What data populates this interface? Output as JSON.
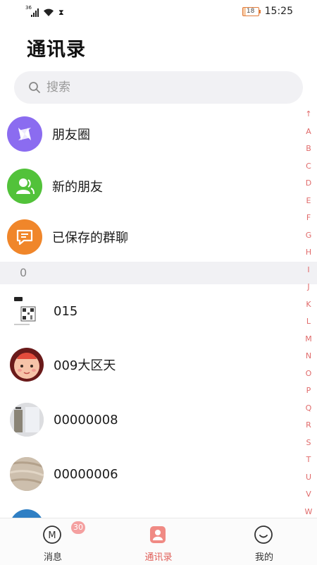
{
  "status": {
    "network": "36",
    "battery": "18",
    "time": "15:25"
  },
  "header": {
    "title": "通讯录"
  },
  "search": {
    "placeholder": "搜索"
  },
  "features": [
    {
      "label": "朋友圈",
      "icon": "pinwheel-icon",
      "color": "#8b6cf0"
    },
    {
      "label": "新的朋友",
      "icon": "people-icon",
      "color": "#52c23a"
    },
    {
      "label": "已保存的群聊",
      "icon": "chat-bubble-icon",
      "color": "#f0862a"
    }
  ],
  "section": {
    "letter": "0"
  },
  "contacts": [
    {
      "name": "015",
      "avatar": "qr-code-avatar"
    },
    {
      "name": "009大区天",
      "avatar": "baby-face-avatar"
    },
    {
      "name": "00000008",
      "avatar": "photo-avatar"
    },
    {
      "name": "00000006",
      "avatar": "texture-avatar"
    }
  ],
  "index": [
    "↑",
    "A",
    "B",
    "C",
    "D",
    "E",
    "F",
    "G",
    "H",
    "I",
    "J",
    "K",
    "L",
    "M",
    "N",
    "O",
    "P",
    "Q",
    "R",
    "S",
    "T",
    "U",
    "V",
    "W"
  ],
  "tabs": [
    {
      "label": "消息",
      "badge": "30",
      "icon": "message-m-icon"
    },
    {
      "label": "通讯录",
      "icon": "contacts-icon",
      "active": true
    },
    {
      "label": "我的",
      "icon": "profile-icon"
    }
  ],
  "colors": {
    "accent": "#e0605a",
    "index": "#e06a6a",
    "badge": "#f4a0a0"
  }
}
